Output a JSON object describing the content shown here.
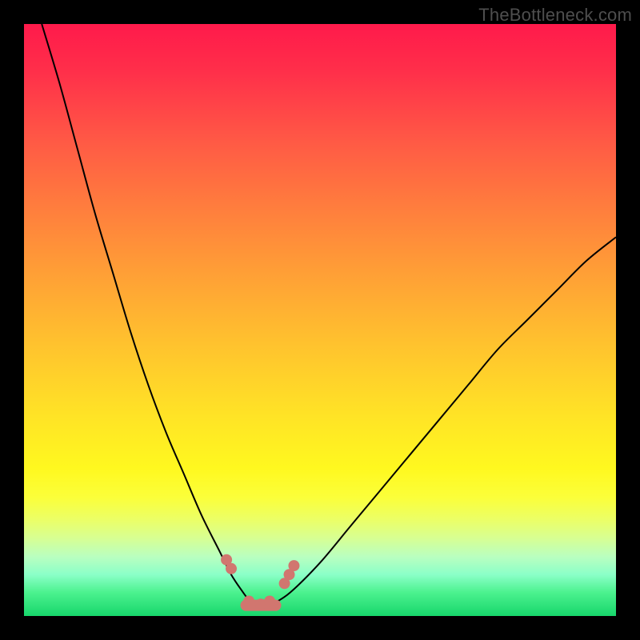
{
  "watermark": "TheBottleneck.com",
  "colors": {
    "frame": "#000000",
    "curve": "#000000",
    "marker": "#d1766f",
    "gradient_top": "#ff1a4b",
    "gradient_bottom": "#17d66b"
  },
  "chart_data": {
    "type": "line",
    "title": "",
    "xlabel": "",
    "ylabel": "",
    "xlim": [
      0,
      100
    ],
    "ylim": [
      0,
      100
    ],
    "grid": false,
    "legend": false,
    "series": [
      {
        "name": "left-curve",
        "x": [
          3,
          6,
          9,
          12,
          15,
          18,
          21,
          24,
          27,
          30,
          33,
          35,
          37,
          38.5
        ],
        "y": [
          100,
          90,
          79,
          68,
          58,
          48,
          39,
          31,
          24,
          17,
          11,
          7,
          4,
          2
        ]
      },
      {
        "name": "right-curve",
        "x": [
          42,
          45,
          50,
          55,
          60,
          65,
          70,
          75,
          80,
          85,
          90,
          95,
          100
        ],
        "y": [
          2,
          4,
          9,
          15,
          21,
          27,
          33,
          39,
          45,
          50,
          55,
          60,
          64
        ]
      }
    ],
    "markers": {
      "name": "highlight-dots",
      "x": [
        34.2,
        35.0,
        38.0,
        40.0,
        41.5,
        44.0,
        44.8,
        45.6
      ],
      "y": [
        9.5,
        8.0,
        2.5,
        2.0,
        2.5,
        5.5,
        7.0,
        8.5
      ]
    },
    "flat_segment": {
      "x": [
        37.5,
        42.5
      ],
      "y": [
        1.8,
        1.8
      ]
    }
  }
}
